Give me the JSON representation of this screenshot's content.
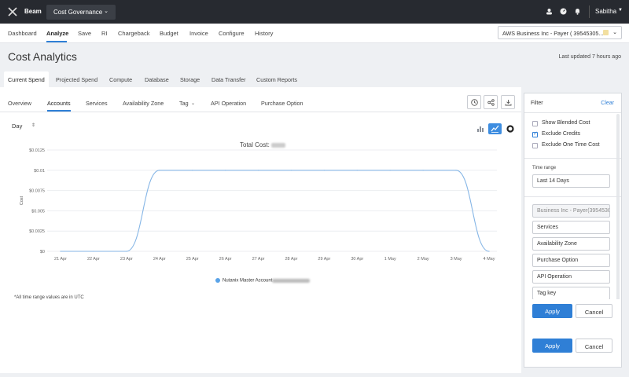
{
  "topbar": {
    "brand": "Beam",
    "module": "Cost Governance",
    "user": "Sabitha"
  },
  "nav": {
    "items": [
      "Dashboard",
      "Analyze",
      "Save",
      "RI",
      "Chargeback",
      "Budget",
      "Invoice",
      "Configure",
      "History"
    ],
    "active": "Analyze"
  },
  "account": {
    "value": "AWS  Business Inc - Payer ( 39545305..."
  },
  "page": {
    "title": "Cost Analytics",
    "updated": "Last updated 7 hours ago"
  },
  "subtabs": {
    "items": [
      "Current Spend",
      "Projected Spend",
      "Compute",
      "Database",
      "Storage",
      "Data Transfer",
      "Custom Reports"
    ],
    "active": "Current Spend"
  },
  "viewtabs": {
    "items": [
      "Overview",
      "Accounts",
      "Services",
      "Availability Zone",
      "Tag",
      "API Operation",
      "Purchase Option"
    ],
    "active": "Accounts"
  },
  "granularity": "Day",
  "chart_title": "Total Cost:",
  "chart_data": {
    "type": "line",
    "x": [
      "21 Apr",
      "22 Apr",
      "23 Apr",
      "24 Apr",
      "25 Apr",
      "26 Apr",
      "27 Apr",
      "28 Apr",
      "29 Apr",
      "30 Apr",
      "1 May",
      "2 May",
      "3 May",
      "4 May"
    ],
    "series": [
      {
        "name": "Nutanix Master Account",
        "values": [
          0,
          0,
          0,
          0.01,
          0.01,
          0.01,
          0.01,
          0.01,
          0.01,
          0.01,
          0.01,
          0.01,
          0.01,
          0
        ]
      }
    ],
    "ylabel": "Cost",
    "yticks": [
      "$0",
      "$0.0025",
      "$0.005",
      "$0.0075",
      "$0.01",
      "$0.0125"
    ],
    "ylim": [
      0,
      0.0125
    ],
    "color": "#86b6e6"
  },
  "legend_label": "Nutanix Master Account",
  "footnote": "*All time range values are in UTC",
  "filter": {
    "title": "Filter",
    "clear": "Clear",
    "checkboxes": [
      {
        "label": "Show Blended Cost",
        "checked": false
      },
      {
        "label": "Exclude Credits",
        "checked": true
      },
      {
        "label": "Exclude One Time Cost",
        "checked": false
      }
    ],
    "time_range_label": "Time range",
    "time_range": "Last 14 Days",
    "account_field": "Business Inc - Payer(395453C",
    "services": "Services",
    "availability_zone": "Availability Zone",
    "purchase_option": "Purchase Option",
    "api_operation": "API Operation",
    "tag_key": "Tag key",
    "apply": "Apply",
    "cancel": "Cancel"
  },
  "colors": {
    "accent": "#2f7fd6",
    "topbar": "#272a30"
  }
}
